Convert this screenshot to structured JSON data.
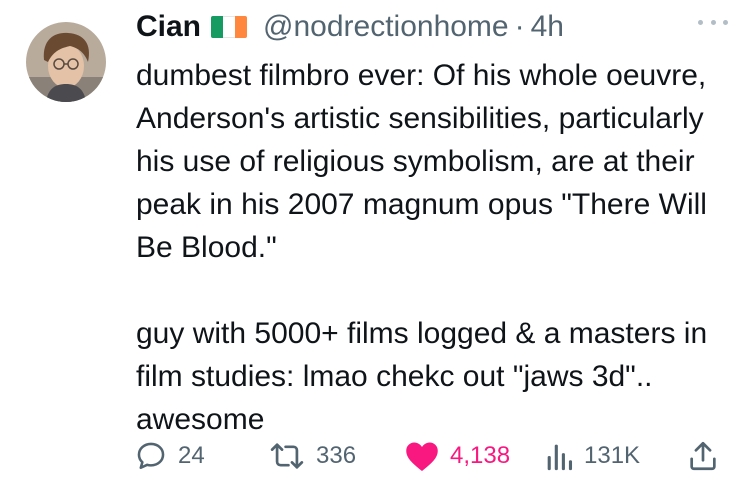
{
  "user": {
    "display_name": "Cian",
    "handle": "@nodrectionhome",
    "separator": "·",
    "time": "4h",
    "flag_icon": "ireland-flag-icon"
  },
  "tweet": {
    "paragraph_1": "dumbest filmbro ever: Of his whole oeuvre, Anderson's artistic sensibilities, particularly his use of religious symbolism, are at their peak in his 2007 magnum opus \"There Will Be Blood.\"",
    "paragraph_2": "guy with 5000+ films logged & a masters in film studies: lmao chekc out \"jaws 3d\".. awesome"
  },
  "actions": {
    "replies": "24",
    "retweets": "336",
    "likes": "4,138",
    "views": "131K"
  },
  "colors": {
    "text": "#0f1419",
    "muted": "#536471",
    "like": "#f91880",
    "flag_green": "#169b62",
    "flag_white": "#ffffff",
    "flag_orange": "#ff883e"
  }
}
